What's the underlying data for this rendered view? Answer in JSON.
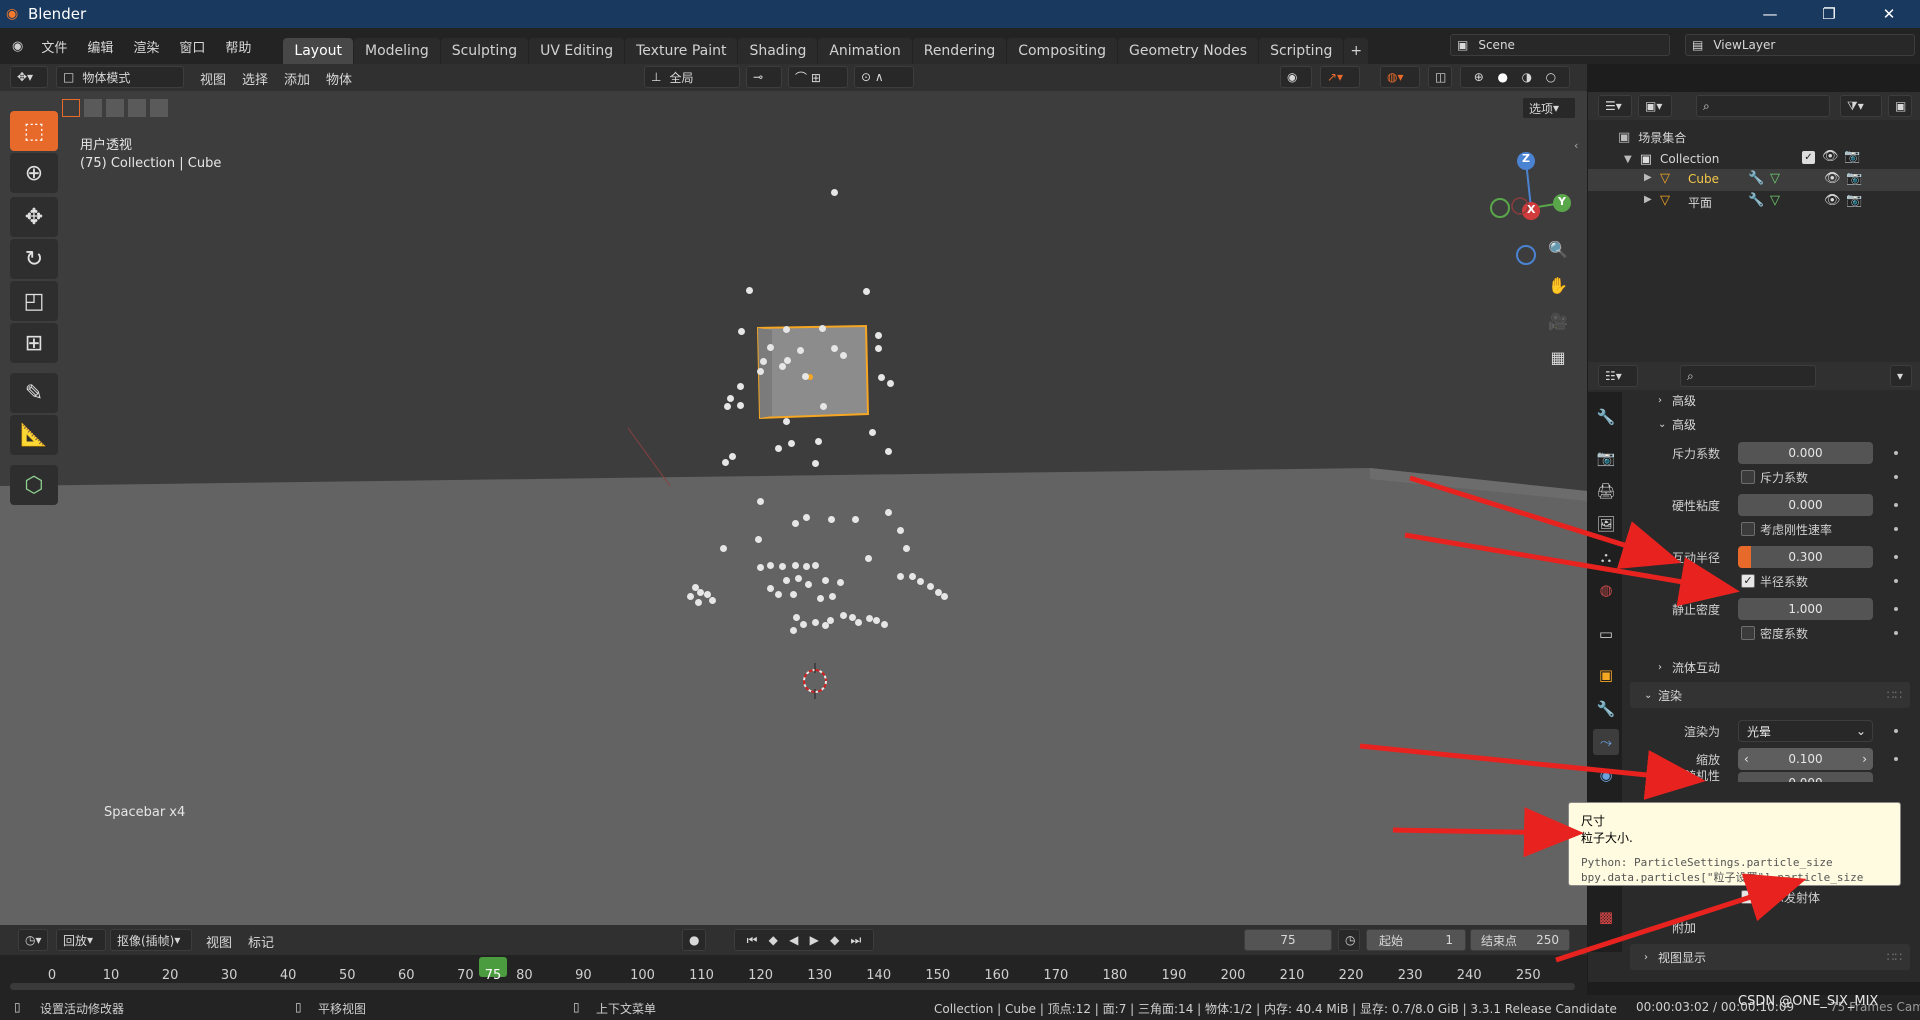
{
  "app": {
    "title": "Blender"
  },
  "menu": [
    "文件",
    "编辑",
    "渲染",
    "窗口",
    "帮助"
  ],
  "workspaces": [
    "Layout",
    "Modeling",
    "Sculpting",
    "UV Editing",
    "Texture Paint",
    "Shading",
    "Animation",
    "Rendering",
    "Compositing",
    "Geometry Nodes",
    "Scripting"
  ],
  "active_workspace": "Layout",
  "scene": {
    "label": "Scene"
  },
  "view_layer": {
    "label": "ViewLayer"
  },
  "viewport_header": {
    "mode": "物体模式",
    "menus": [
      "视图",
      "选择",
      "添加",
      "物体"
    ],
    "transform_orientation": "全局",
    "options": "选项"
  },
  "viewport": {
    "view_name": "用户透视",
    "collection_info": "(75) Collection | Cube",
    "key_hint": "Spacebar x4"
  },
  "gizmo": {
    "x": "X",
    "y": "Y",
    "z": "Z"
  },
  "outliner": {
    "scene_collection": "场景集合",
    "collection": "Collection",
    "items": [
      "Cube",
      "平面"
    ]
  },
  "properties": {
    "sections": {
      "advanced_collapsed": "高级",
      "advanced": "高级",
      "fluid_interaction": "流体互动",
      "render": "渲染",
      "extra": "附加",
      "viewport_display": "视图显示"
    },
    "fields": {
      "repulsion_label": "斥力系数",
      "repulsion_value": "0.000",
      "repulsion_check": "斥力系数",
      "stiff_viscosity_label": "硬性粘度",
      "stiff_viscosity_value": "0.000",
      "consider_stiff_check": "考虑刚性速率",
      "interaction_radius_label": "互动半径",
      "interaction_radius_value": "0.300",
      "radius_factor_check": "半径系数",
      "rest_density_label": "静止密度",
      "rest_density_value": "1.000",
      "density_factor_check": "密度系数",
      "render_as_label": "渲染为",
      "render_as_value": "光晕",
      "scale_label": "缩放",
      "scale_value": "0.100",
      "scale_random_label": "缩放随机性",
      "scale_random_value": "0.000",
      "show_emitter_check": "显示发射体"
    },
    "checks": {
      "repulsion": false,
      "consider_stiff": false,
      "radius_factor": true,
      "density_factor": false,
      "show_emitter": true
    }
  },
  "tooltip": {
    "title": "尺寸",
    "desc": "粒子大小.",
    "python1": "Python: ParticleSettings.particle_size",
    "python2": "bpy.data.particles[\"粒子设置\"].particle_size"
  },
  "timeline": {
    "menus": [
      "回放",
      "抠像(插帧)",
      "视图",
      "标记"
    ],
    "current_frame": "75",
    "start_label": "起始",
    "start_value": "1",
    "end_label": "结束点",
    "end_value": "250",
    "ticks": [
      "0",
      "10",
      "20",
      "30",
      "40",
      "50",
      "60",
      "70",
      "80",
      "90",
      "100",
      "110",
      "120",
      "130",
      "140",
      "150",
      "160",
      "170",
      "180",
      "190",
      "200",
      "210",
      "220",
      "230",
      "240",
      "250"
    ]
  },
  "status": {
    "left1": "设置活动修改器",
    "left2": "平移视图",
    "left3": "上下文菜单",
    "info": "Collection | Cube | 顶点:12 | 面:7 | 三角面:14 | 物体:1/2 | 内存: 40.4 MiB | 显存: 0.7/8.0 GiB | 3.3.1 Release Candidate",
    "time": "00:00:03:02 / 00:00:10:09",
    "frames": "75 Frames Cam",
    "watermark": "CSDN @ONE_SIX_MIX"
  },
  "colors": {
    "accent": "#e76a2b",
    "selected": "#f5a623",
    "active_frame": "#4b9b3f",
    "arrow": "#e8231f"
  }
}
